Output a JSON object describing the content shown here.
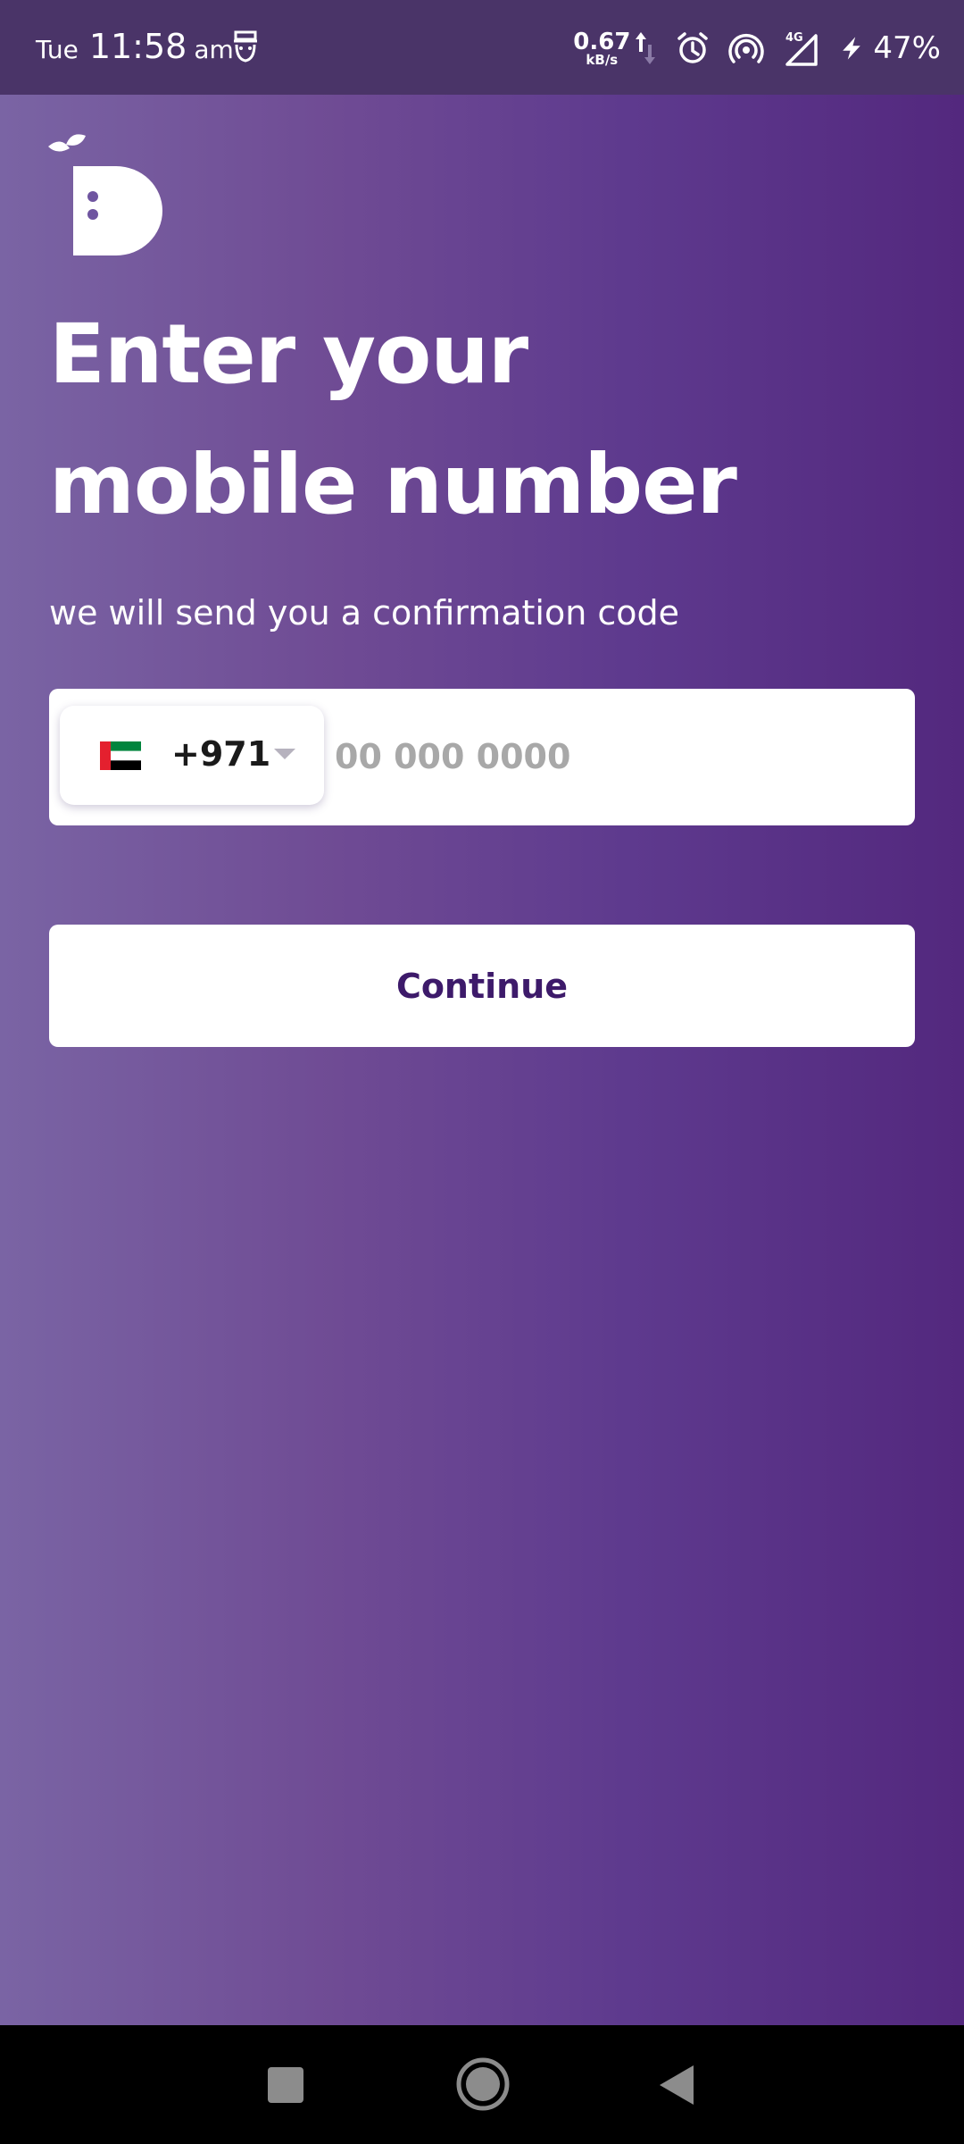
{
  "status_bar": {
    "day": "Tue",
    "time": "11:58",
    "ampm": "am",
    "net_speed": "0.67",
    "net_speed_unit": "kB/s",
    "network_type": "4G",
    "battery": "47%",
    "icons": [
      "privacy-icon",
      "data-arrows-icon",
      "alarm-icon",
      "hotspot-icon",
      "signal-icon",
      "charging-icon"
    ]
  },
  "login": {
    "logo_icon": "app-logo-d",
    "title_line1": "Enter your",
    "title_line2": "mobile number",
    "subtitle": "we will send you a confirmation code",
    "country_flag_icon": "uae-flag-icon",
    "country_code": "+971",
    "phone_placeholder": "00 000 0000",
    "phone_value": "",
    "continue_label": "Continue"
  },
  "nav_bar": {
    "icons": [
      "recents-icon",
      "home-icon",
      "back-icon"
    ]
  },
  "colors": {
    "status_bar_bg": "#4a3468",
    "gradient_left": "#7a64a4",
    "gradient_right": "#53287e",
    "button_text": "#3d1a6a",
    "placeholder": "#a8a8a8"
  }
}
